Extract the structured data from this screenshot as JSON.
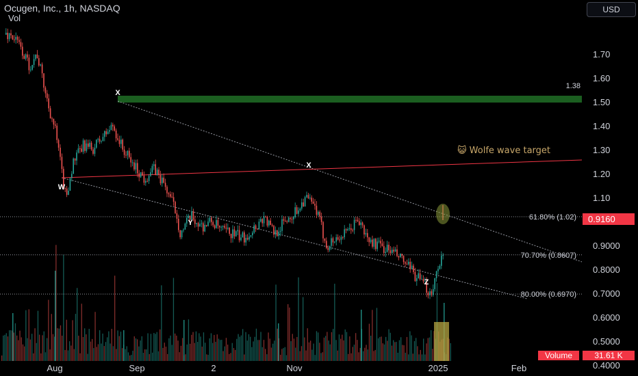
{
  "header": {
    "title": "Ocugen, Inc., 1h, NASDAQ",
    "volume_label": "Vol"
  },
  "currency_button": "USD",
  "colors": {
    "up": "#26a69a",
    "down": "#ef5350",
    "background": "#000000",
    "target_band": "#1b5e20",
    "red_line": "#f23645",
    "highlight_volume": "#b5a642",
    "highlight_circle": "#8a9a3a"
  },
  "current_price": "0.9160",
  "volume": {
    "label": "Volume",
    "value": "31.61 K"
  },
  "target_level": "1.38",
  "wolfe_label": "😺 Wolfe wave target",
  "fib_levels": [
    {
      "label": "61.80% (1.02)",
      "price": 1.02
    },
    {
      "label": "70.70% (0.8607)",
      "price": 0.8607
    },
    {
      "label": "80.00% (0.6970)",
      "price": 0.697
    }
  ],
  "wave_points": [
    {
      "label": "X",
      "date": "2024-08-23",
      "price": 1.41
    },
    {
      "label": "W",
      "date": "2024-08-05",
      "price": 1.08
    },
    {
      "label": "Y",
      "date": "2024-09-18",
      "price": 0.94
    },
    {
      "label": "X",
      "date": "2024-11-05",
      "price": 1.12
    },
    {
      "label": "Z",
      "date": "2024-12-23",
      "price": 0.69
    }
  ],
  "chart_data": {
    "type": "candlestick",
    "title": "Ocugen, Inc., 1h, NASDAQ",
    "y_ticks": [
      "1.70",
      "1.60",
      "1.50",
      "1.40",
      "1.30",
      "1.20",
      "1.10",
      "1.0000",
      "0.9000",
      "0.8000",
      "0.7000",
      "0.6000",
      "0.5000",
      "0.4000"
    ],
    "x_ticks": [
      "Aug",
      "Sep",
      "2",
      "Nov",
      "2025",
      "Feb"
    ],
    "ylim": [
      0.36,
      1.85
    ],
    "price_path": [
      [
        "2024-07-15",
        1.78
      ],
      [
        "2024-07-18",
        1.74
      ],
      [
        "2024-07-22",
        1.65
      ],
      [
        "2024-07-25",
        1.7
      ],
      [
        "2024-07-29",
        1.5
      ],
      [
        "2024-08-01",
        1.38
      ],
      [
        "2024-08-05",
        1.1
      ],
      [
        "2024-08-08",
        1.25
      ],
      [
        "2024-08-12",
        1.32
      ],
      [
        "2024-08-15",
        1.3
      ],
      [
        "2024-08-19",
        1.35
      ],
      [
        "2024-08-23",
        1.4
      ],
      [
        "2024-08-27",
        1.3
      ],
      [
        "2024-08-30",
        1.25
      ],
      [
        "2024-09-04",
        1.18
      ],
      [
        "2024-09-08",
        1.22
      ],
      [
        "2024-09-12",
        1.15
      ],
      [
        "2024-09-16",
        1.05
      ],
      [
        "2024-09-18",
        0.95
      ],
      [
        "2024-09-22",
        1.02
      ],
      [
        "2024-09-26",
        0.98
      ],
      [
        "2024-09-30",
        1.0
      ],
      [
        "2024-10-04",
        0.96
      ],
      [
        "2024-10-08",
        0.95
      ],
      [
        "2024-10-12",
        0.93
      ],
      [
        "2024-10-16",
        0.97
      ],
      [
        "2024-10-20",
        1.02
      ],
      [
        "2024-10-24",
        0.95
      ],
      [
        "2024-10-28",
        1.0
      ],
      [
        "2024-11-01",
        1.04
      ],
      [
        "2024-11-05",
        1.1
      ],
      [
        "2024-11-09",
        1.05
      ],
      [
        "2024-11-13",
        0.9
      ],
      [
        "2024-11-17",
        0.93
      ],
      [
        "2024-11-21",
        0.95
      ],
      [
        "2024-11-25",
        1.01
      ],
      [
        "2024-11-29",
        0.92
      ],
      [
        "2024-12-03",
        0.9
      ],
      [
        "2024-12-07",
        0.88
      ],
      [
        "2024-12-11",
        0.85
      ],
      [
        "2024-12-15",
        0.8
      ],
      [
        "2024-12-19",
        0.75
      ],
      [
        "2024-12-23",
        0.7
      ],
      [
        "2024-12-25",
        0.78
      ],
      [
        "2024-12-27",
        0.86
      ],
      [
        "2024-12-29",
        0.82
      ],
      [
        "2024-12-31",
        0.84
      ],
      [
        "2025-01-02",
        0.92
      ]
    ],
    "volume_max_label": "",
    "series": [
      {
        "name": "Vol",
        "values": []
      }
    ]
  }
}
